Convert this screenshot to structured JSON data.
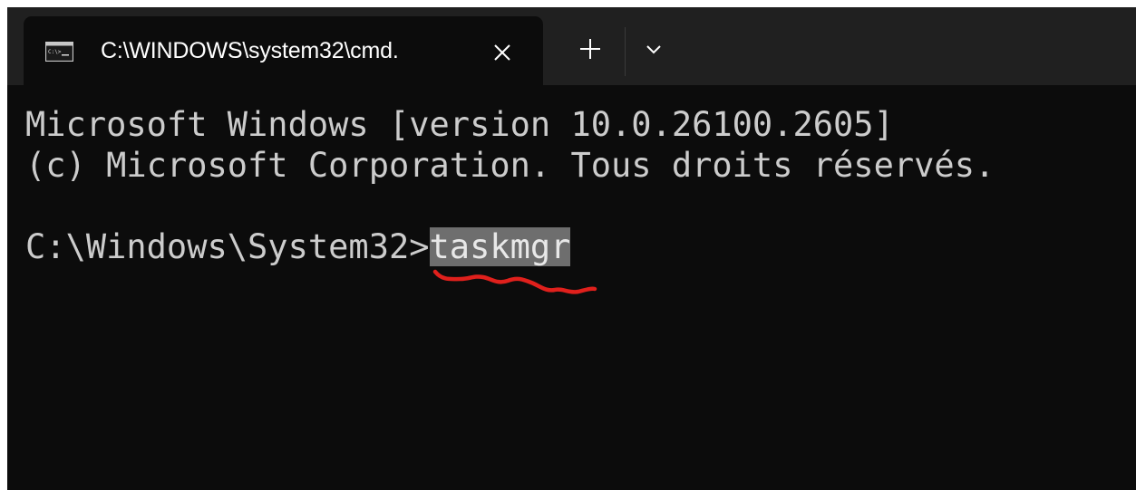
{
  "window": {
    "tab": {
      "title": "C:\\WINDOWS\\system32\\cmd.",
      "icon": "cmd-icon",
      "close_icon": "close-icon"
    },
    "new_tab_icon": "plus-icon",
    "dropdown_icon": "chevron-down-icon"
  },
  "terminal": {
    "line1": "Microsoft Windows [version 10.0.26100.2605]",
    "line2": "(c) Microsoft Corporation. Tous droits réservés.",
    "prompt": "C:\\Windows\\System32>",
    "command": "taskmgr"
  },
  "colors": {
    "background": "#0c0c0c",
    "titlebar": "#202020",
    "text": "#cccccc",
    "selection": "#6e6e6e",
    "annotation": "#e0201c"
  }
}
